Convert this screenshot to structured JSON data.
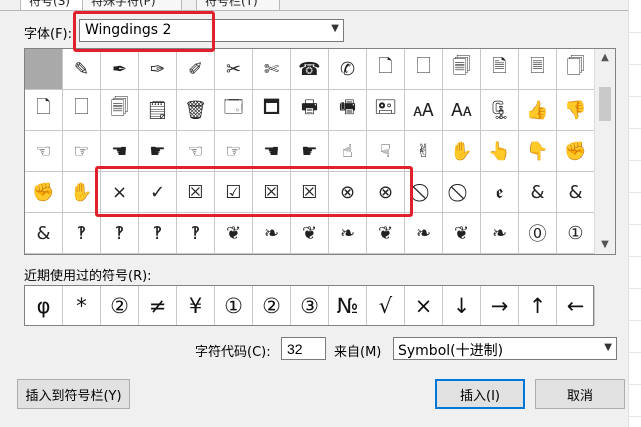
{
  "tabs": [
    {
      "label": "符号(S)",
      "active": true
    },
    {
      "label": "特殊字符(P)",
      "active": false
    },
    {
      "label": "符号栏(T)",
      "active": false
    }
  ],
  "font": {
    "label": "字体(F):",
    "value": "Wingdings 2"
  },
  "symbol_grid": {
    "rows": [
      [
        "",
        "✎",
        "✒",
        "✑",
        "✐",
        "✂",
        "✄",
        "☎",
        "✆",
        "🗋",
        "🗌",
        "🗐",
        "🗎",
        "🗏",
        "🗍"
      ],
      [
        "🗋",
        "🗌",
        "🗐",
        "🗒",
        "🗑",
        "🗔",
        "🗖",
        "🖶",
        "🖷",
        "🖭",
        "🗚",
        "🗛",
        "🗜",
        "👍",
        "👎"
      ],
      [
        "☜",
        "☞",
        "☚",
        "☛",
        "☜",
        "☞",
        "☚",
        "☛",
        "☝",
        "☟",
        "✌",
        "✋",
        "👆",
        "👇",
        "✊"
      ],
      [
        "✊",
        "✋",
        "×",
        "✓",
        "☒",
        "☑",
        "☒",
        "☒",
        "⊗",
        "⊗",
        "⃠",
        "⃠",
        "ꬲ",
        "&",
        "&"
      ],
      [
        "&",
        "‽",
        "‽",
        "‽",
        "‽",
        "❦",
        "❧",
        "❦",
        "❧",
        "❦",
        "❧",
        "❦",
        "❧",
        "⓪",
        "①"
      ]
    ]
  },
  "recent": {
    "label": "近期使用过的符号(R):",
    "items": [
      "φ",
      "*",
      "②",
      "≠",
      "¥",
      "①",
      "②",
      "③",
      "№",
      "√",
      "×",
      "↓",
      "→",
      "↑",
      "←"
    ]
  },
  "char_code": {
    "label": "字符代码(C):",
    "value": "32"
  },
  "from": {
    "label": "来自(M)",
    "value": "Symbol(十进制)"
  },
  "buttons": {
    "insert_to_bar": "插入到符号栏(Y)",
    "insert": "插入(I)",
    "cancel": "取消"
  },
  "colors": {
    "highlight": "#e0202a",
    "selected_cell": "#a9a9a9",
    "focus": "#0078d7"
  }
}
